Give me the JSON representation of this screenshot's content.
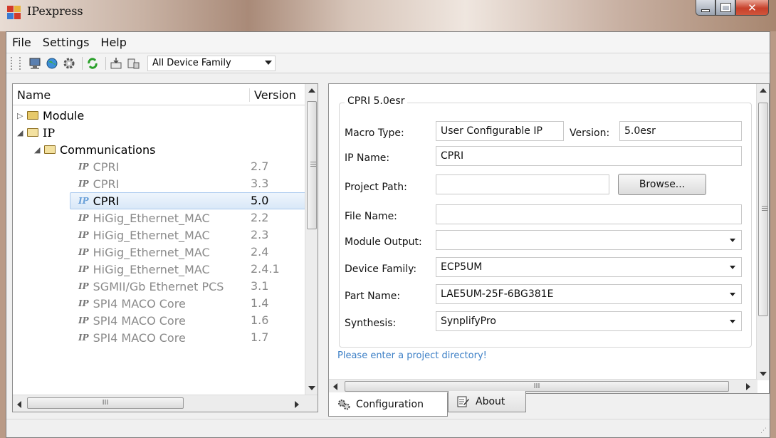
{
  "window": {
    "title": "IPexpress"
  },
  "menu": [
    "File",
    "Settings",
    "Help"
  ],
  "toolbar": {
    "device_family": "All Device Family",
    "icons": [
      "computer-icon",
      "globe-icon",
      "gear-icon",
      "refresh-icon",
      "import-icon",
      "export-icon"
    ]
  },
  "tree": {
    "col_name": "Name",
    "col_version": "Version",
    "module": "Module",
    "ip": "IP",
    "communications": "Communications",
    "items": [
      {
        "name": "CPRI",
        "version": "2.7"
      },
      {
        "name": "CPRI",
        "version": "3.3"
      },
      {
        "name": "CPRI",
        "version": "5.0"
      },
      {
        "name": "HiGig_Ethernet_MAC",
        "version": "2.2"
      },
      {
        "name": "HiGig_Ethernet_MAC",
        "version": "2.3"
      },
      {
        "name": "HiGig_Ethernet_MAC",
        "version": "2.4"
      },
      {
        "name": "HiGig_Ethernet_MAC",
        "version": "2.4.1"
      },
      {
        "name": "SGMII/Gb Ethernet PCS",
        "version": "3.1"
      },
      {
        "name": "SPI4 MACO Core",
        "version": "1.4"
      },
      {
        "name": "SPI4 MACO Core",
        "version": "1.6"
      },
      {
        "name": "SPI4 MACO Core",
        "version": "1.7"
      }
    ],
    "ip_glyph": "IP",
    "hscroll_grip": "III"
  },
  "config": {
    "group_title": "CPRI 5.0esr",
    "macro_type_label": "Macro Type:",
    "macro_type_value": "User Configurable IP",
    "version_label": "Version:",
    "version_value": "5.0esr",
    "ip_name_label": "IP Name:",
    "ip_name_value": "CPRI",
    "project_path_label": "Project Path:",
    "project_path_value": "",
    "browse_label": "Browse...",
    "file_name_label": "File Name:",
    "file_name_value": "",
    "module_output_label": "Module Output:",
    "module_output_value": "",
    "device_family_label": "Device Family:",
    "device_family_value": "ECP5UM",
    "part_name_label": "Part Name:",
    "part_name_value": "LAE5UM-25F-6BG381E",
    "synthesis_label": "Synthesis:",
    "synthesis_value": "SynplifyPro",
    "status_message": "Please enter a project directory!",
    "hscroll_grip": "III"
  },
  "tabs": {
    "configuration": "Configuration",
    "about": "About"
  }
}
